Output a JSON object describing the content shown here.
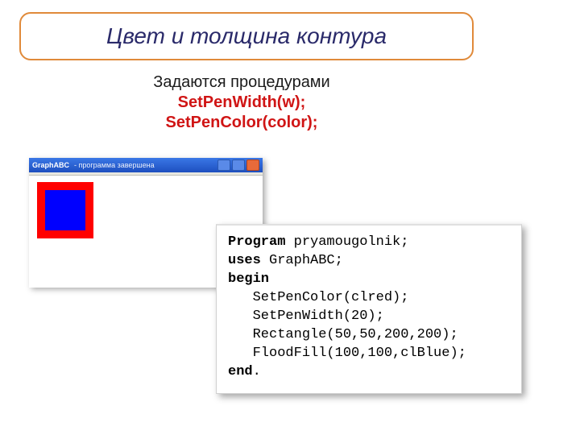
{
  "title": "Цвет и толщина контура",
  "subtitle_line1": "Задаются процедурами",
  "subtitle_line2": "SetPenWidth(w);",
  "subtitle_line3": "SetPenColor(color);",
  "window": {
    "app_name": "GraphABC",
    "doc_label": "- программа завершена"
  },
  "code": {
    "l1_kw": "Program",
    "l1_rest": " pryamougolnik;",
    "l2_kw": "uses",
    "l2_rest": " GraphABC;",
    "l3_kw": "begin",
    "l4": "   SetPenColor(clred);",
    "l5": "   SetPenWidth(20);",
    "l6": "   Rectangle(50,50,200,200);",
    "l7": "   FloodFill(100,100,clBlue);",
    "l8_kw": "end",
    "l8_rest": "."
  }
}
